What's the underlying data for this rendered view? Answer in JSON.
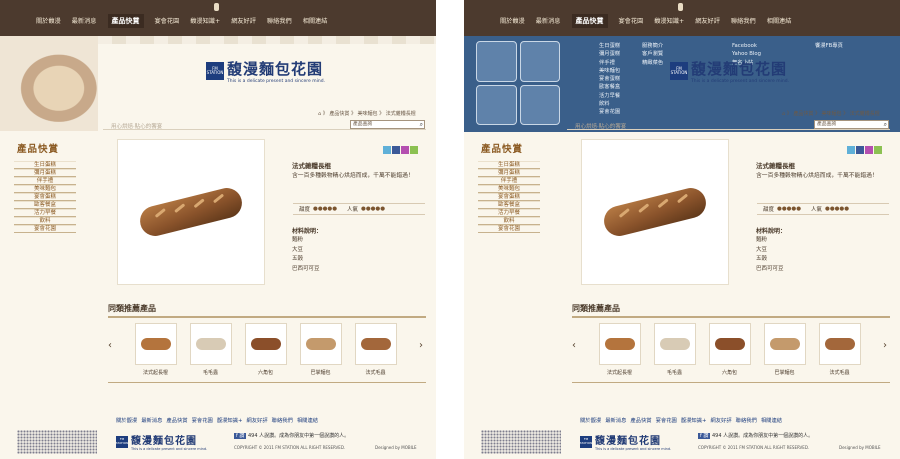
{
  "nav": {
    "items": [
      "關於馥漫",
      "最新消息",
      "產品快賞",
      "宴會花園",
      "馥漫知識+",
      "網友好評",
      "聯絡我們",
      "相關連結"
    ],
    "active": "產品快賞"
  },
  "brand": {
    "name_cn": "馥漫麵包花園",
    "name_en": "This is a delicate present and sincere mind.",
    "box_text": "FM STATION"
  },
  "breadcrumb": "⌂ 》 產品快賞 》 美味麵包 》 法式雜糧長棍",
  "slogan": "用心烘焙‧貼心的饗宴",
  "search": {
    "placeholder": "產品查詢"
  },
  "sidebar": {
    "title": "產品快賞",
    "items": [
      "生日蛋糕",
      "彌月蛋糕",
      "伴手禮",
      "美味麵包",
      "宴會蛋糕",
      "歐客餐盒",
      "活力早餐",
      "飲料",
      "宴會花園"
    ]
  },
  "product": {
    "name": "法式雜糧長棍",
    "desc": "含一百多種穀物精心烘焙而成，千萬不能錯過！",
    "rating_label1": "甜度",
    "rating_label2": "人氣",
    "rating_dots": "●●●●●",
    "materials_title": "材料說明：",
    "materials": [
      "麵粉",
      "大豆",
      "五穀",
      "巴西可可豆"
    ]
  },
  "recommend": {
    "title": "同類推薦產品",
    "items": [
      "法式起長棍",
      "毛毛蟲",
      "六角包",
      "巴掌麵包",
      "法式毛蟲"
    ],
    "prev": "‹",
    "next": "›"
  },
  "footer": {
    "nav": [
      "關於馥漫",
      "最新消息",
      "產品快賞",
      "宴會花園",
      "馥漫知識+",
      "網友好評",
      "聯絡我們",
      "相關連結"
    ],
    "fb": "494 人說讚。成為你朋友中第一個說讚的人。",
    "copyright": "COPYRIGHT © 2011 FM STATION ALL RIGHT RESERVED.",
    "designed": "Designed by MOBILE"
  },
  "mega": {
    "col1": [
      "生日蛋糕",
      "彌月蛋糕",
      "伴手禮",
      "美味麵包",
      "宴會蛋糕",
      "歐客餐盒",
      "活力早餐",
      "飲料",
      "宴會花園"
    ],
    "col2": [
      "服務簡介",
      "客戶瀏覽",
      "精緻菜色"
    ],
    "col3": [
      "Facebook",
      "Yahoo Blog",
      "無名小站"
    ],
    "col4": [
      "饗漫FB專頁"
    ]
  }
}
